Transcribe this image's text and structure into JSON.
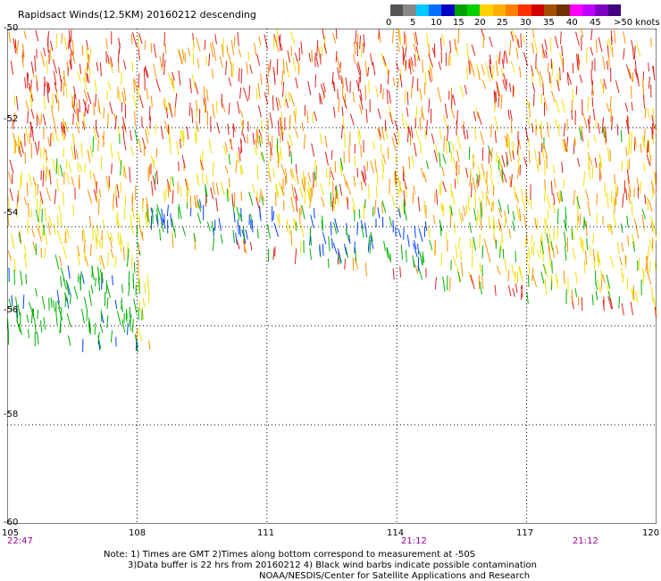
{
  "title": "Rapidsact Winds(12.5KM) 20160212 descending",
  "legend": {
    "labels": [
      "0",
      "5",
      "10",
      "15",
      "20",
      "25",
      "30",
      "35",
      "40",
      "45",
      ">50 knots"
    ],
    "colors": [
      "#555555",
      "#888888",
      "#00c8ff",
      "#0070ff",
      "#0000c0",
      "#00a000",
      "#00d000",
      "#ffd000",
      "#ffb000",
      "#ff8000",
      "#ff3000",
      "#d00000",
      "#a05000",
      "#703000",
      "#ff00ff",
      "#c000ff",
      "#8000c0",
      "#400080"
    ]
  },
  "map": {
    "lon_ticks": [
      "105",
      "108",
      "111",
      "114",
      "117",
      "120"
    ],
    "lat_ticks": [
      "-50",
      "-52",
      "-54",
      "-56",
      "-58",
      "-60"
    ],
    "lon_range": [
      105,
      120
    ],
    "lat_range": [
      -60,
      -50
    ],
    "pass_times": [
      "22:47",
      "21:12",
      "21:12"
    ],
    "gridlines": true,
    "gridline_style": "dotted"
  },
  "notes": {
    "line1": "Note: 1) Times are GMT 2)Times along bottom correspond to measurement at -50S",
    "line2": "3)Data buffer is 22 hrs from 20160212 4) Black wind barbs indicate possible contamination",
    "line3": "NOAA/NESDIS/Center for Satellite Applications and Research"
  },
  "swath_colors": {
    "strong": "#e02020",
    "moderate": "#ff9000",
    "light": "#f0e000",
    "weak": "#00b000",
    "calm": "#0040ff"
  }
}
